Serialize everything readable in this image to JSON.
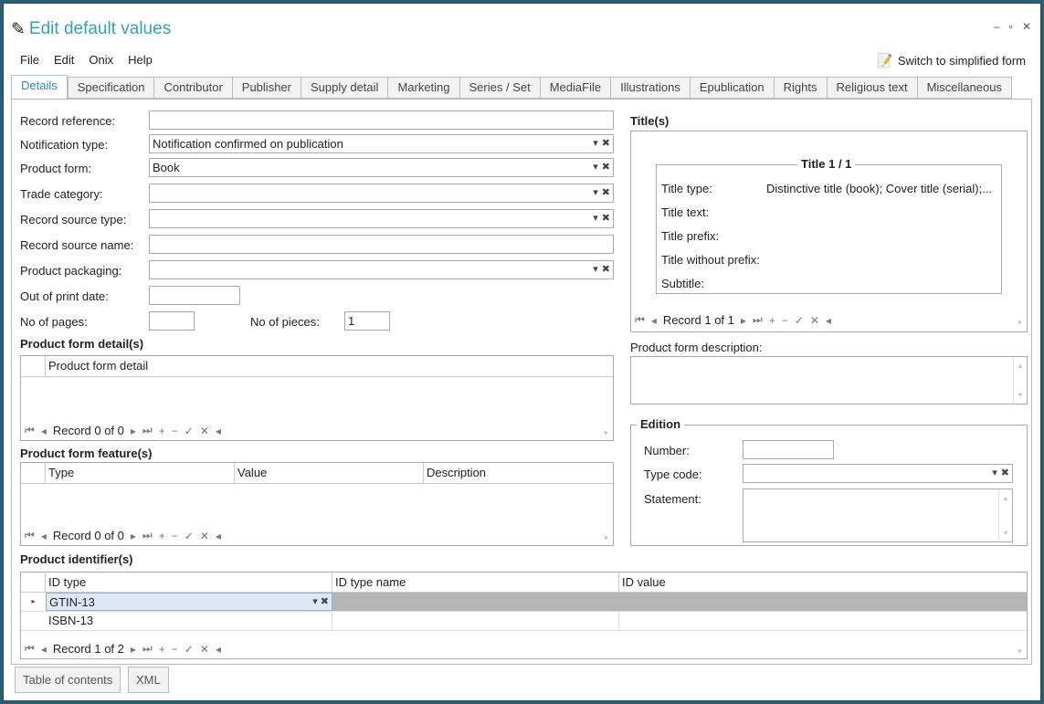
{
  "window": {
    "title": "Edit default values"
  },
  "menu": [
    "File",
    "Edit",
    "Onix",
    "Help"
  ],
  "switch_label": "Switch to simplified form",
  "tabs": [
    "Details",
    "Specification",
    "Contributor",
    "Publisher",
    "Supply detail",
    "Marketing",
    "Series / Set",
    "MediaFile",
    "Illustrations",
    "Epublication",
    "Rights",
    "Religious text",
    "Miscellaneous"
  ],
  "left": {
    "record_reference": {
      "label": "Record reference:",
      "value": ""
    },
    "notification_type": {
      "label": "Notification type:",
      "value": "Notification confirmed on publication"
    },
    "product_form": {
      "label": "Product form:",
      "value": "Book"
    },
    "trade_category": {
      "label": "Trade category:",
      "value": ""
    },
    "record_source_type": {
      "label": "Record source type:",
      "value": ""
    },
    "record_source_name": {
      "label": "Record source name:",
      "value": ""
    },
    "product_packaging": {
      "label": "Product packaging:",
      "value": ""
    },
    "out_of_print": {
      "label": "Out of print date:",
      "value": ""
    },
    "no_of_pages": {
      "label": "No of pages:",
      "value": ""
    },
    "no_of_pieces": {
      "label": "No of pieces:",
      "value": "1"
    }
  },
  "form_detail": {
    "heading": "Product form detail(s)",
    "col": "Product form detail",
    "record": "Record 0 of 0"
  },
  "form_feature": {
    "heading": "Product form feature(s)",
    "cols": [
      "Type",
      "Value",
      "Description"
    ],
    "record": "Record 0 of 0"
  },
  "identifiers": {
    "heading": "Product identifier(s)",
    "cols": [
      "ID type",
      "ID type name",
      "ID value"
    ],
    "rows": [
      {
        "id_type": "GTIN-13",
        "name": "",
        "value": ""
      },
      {
        "id_type": "ISBN-13",
        "name": "",
        "value": ""
      }
    ],
    "record": "Record 1 of 2"
  },
  "titles": {
    "heading": "Title(s)",
    "group": "Title 1 / 1",
    "title_type_label": "Title type:",
    "title_type_value": "Distinctive title (book); Cover title (serial);...",
    "title_text_label": "Title text:",
    "title_prefix_label": "Title prefix:",
    "title_without_prefix_label": "Title without prefix:",
    "subtitle_label": "Subtitle:",
    "record": "Record 1 of 1"
  },
  "form_description": {
    "label": "Product form description:",
    "value": ""
  },
  "edition": {
    "legend": "Edition",
    "number_label": "Number:",
    "type_code_label": "Type code:",
    "statement_label": "Statement:"
  },
  "bottom": {
    "toc": "Table of contents",
    "xml": "XML"
  },
  "nav_icons": {
    "first": "⏮",
    "prev": "◂",
    "next": "▸",
    "last": "⏭",
    "add": "+",
    "remove": "−",
    "ok": "✓",
    "cancel": "✕"
  }
}
